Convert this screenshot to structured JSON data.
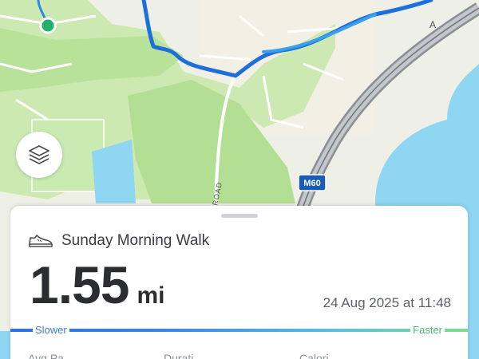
{
  "map": {
    "road_label": "ROAD",
    "motorway_label": "M60",
    "partial_label_right": "A",
    "colors": {
      "water": "#8fd6f2",
      "park": "#c5e7a8",
      "land": "#eef0e8",
      "route": "#1e6fdc",
      "start_marker": "#20b26b"
    }
  },
  "layers_button": {
    "icon": "layers-icon"
  },
  "sheet": {
    "activity_icon": "shoe-icon",
    "activity_name": "Sunday Morning Walk",
    "distance_value": "1.55",
    "distance_unit": "mi",
    "date_time": "24 Aug 2025 at 11:48",
    "pace": {
      "slower_label": "Slower",
      "faster_label": "Faster"
    },
    "stats_partial": [
      "Avg Pa...",
      "Durati...",
      "Calori..."
    ]
  }
}
